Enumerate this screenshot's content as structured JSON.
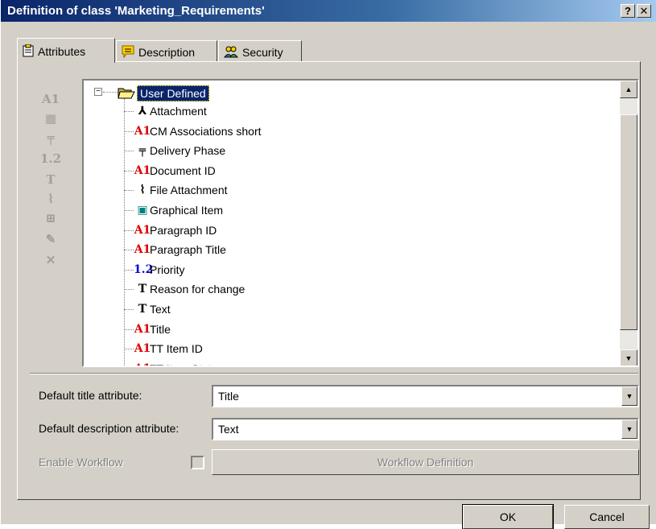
{
  "window": {
    "title": "Definition of class 'Marketing_Requirements'",
    "help_label": "?",
    "close_label": "✕"
  },
  "tabs": [
    {
      "label": "Attributes",
      "icon": "clipboard-icon",
      "active": true
    },
    {
      "label": "Description",
      "icon": "note-icon",
      "active": false
    },
    {
      "label": "Security",
      "icon": "users-icon",
      "active": false
    }
  ],
  "toolbar": [
    {
      "glyph": "A1",
      "icon": "text-attribute-icon"
    },
    {
      "glyph": "▦",
      "icon": "date-attribute-icon"
    },
    {
      "glyph": "╤",
      "icon": "enumeration-attribute-icon"
    },
    {
      "glyph": "1.2",
      "icon": "number-attribute-icon"
    },
    {
      "glyph": "T",
      "icon": "rich-text-attribute-icon"
    },
    {
      "glyph": "⌇",
      "icon": "file-attachment-icon"
    },
    {
      "glyph": "⊞",
      "icon": "group-icon"
    },
    {
      "glyph": "✎",
      "icon": "edit-icon"
    },
    {
      "glyph": "✕",
      "icon": "delete-icon"
    }
  ],
  "tree": {
    "root_label": "User Defined",
    "items": [
      {
        "glyph": "⅄",
        "label": "Attachment",
        "color": "#000000"
      },
      {
        "glyph": "A1",
        "label": "CM Associations short",
        "color": "#e00000"
      },
      {
        "glyph": "╤",
        "label": "Delivery Phase",
        "color": "#000000"
      },
      {
        "glyph": "A1",
        "label": "Document ID",
        "color": "#e00000"
      },
      {
        "glyph": "⌇",
        "label": "File Attachment",
        "color": "#000000"
      },
      {
        "glyph": "▣",
        "label": "Graphical Item",
        "color": "#008080"
      },
      {
        "glyph": "A1",
        "label": "Paragraph ID",
        "color": "#e00000"
      },
      {
        "glyph": "A1",
        "label": "Paragraph Title",
        "color": "#e00000"
      },
      {
        "glyph": "1.2",
        "label": "Priority",
        "color": "#0000e0"
      },
      {
        "glyph": "T",
        "label": "Reason for change",
        "color": "#000000"
      },
      {
        "glyph": "T",
        "label": "Text",
        "color": "#000000"
      },
      {
        "glyph": "A1",
        "label": "Title",
        "color": "#e00000"
      },
      {
        "glyph": "A1",
        "label": "TT Item ID",
        "color": "#e00000"
      },
      {
        "glyph": "A1",
        "label": "TT Item State",
        "color": "#e00000"
      }
    ]
  },
  "form": {
    "default_title_label": "Default title attribute:",
    "default_title_value": "Title",
    "default_desc_label": "Default description attribute:",
    "default_desc_value": "Text",
    "enable_workflow_label": "Enable Workflow",
    "workflow_button": "Workflow Definition"
  },
  "buttons": {
    "ok": "OK",
    "cancel": "Cancel"
  }
}
